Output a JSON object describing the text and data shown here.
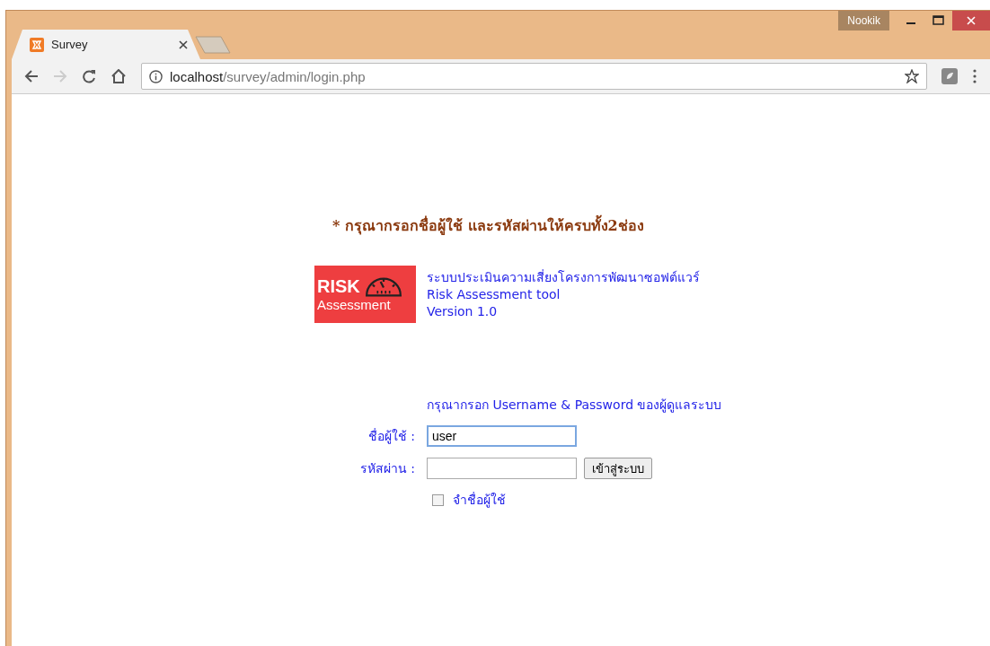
{
  "window": {
    "profile": "Nookik"
  },
  "tabs": [
    {
      "title": "Survey",
      "selected": true
    }
  ],
  "address_bar": {
    "host": "localhost",
    "path": "/survey/admin/login.php"
  },
  "page": {
    "warning": "* กรุณากรอกชื่อผู้ใช้ และรหัสผ่านให้ครบทั้ง2ช่อง",
    "logo": {
      "line1": "RISK",
      "line2": "Assessment"
    },
    "app_lines": [
      "ระบบประเมินความเสี่ยงโครงการพัฒนาซอฟต์แวร์",
      "Risk Assessment tool",
      "Version 1.0"
    ],
    "instruction": "กรุณากรอก Username & Password ของผู้ดูแลระบบ",
    "fields": [
      {
        "label": "ชื่อผู้ใช้ :",
        "value": "user",
        "focused": true
      },
      {
        "label": "รหัสผ่าน :",
        "focused": false
      }
    ],
    "login_button": "เข้าสู่ระบบ",
    "remember": {
      "label": "จำชื่อผู้ใช้",
      "checked": false
    }
  }
}
